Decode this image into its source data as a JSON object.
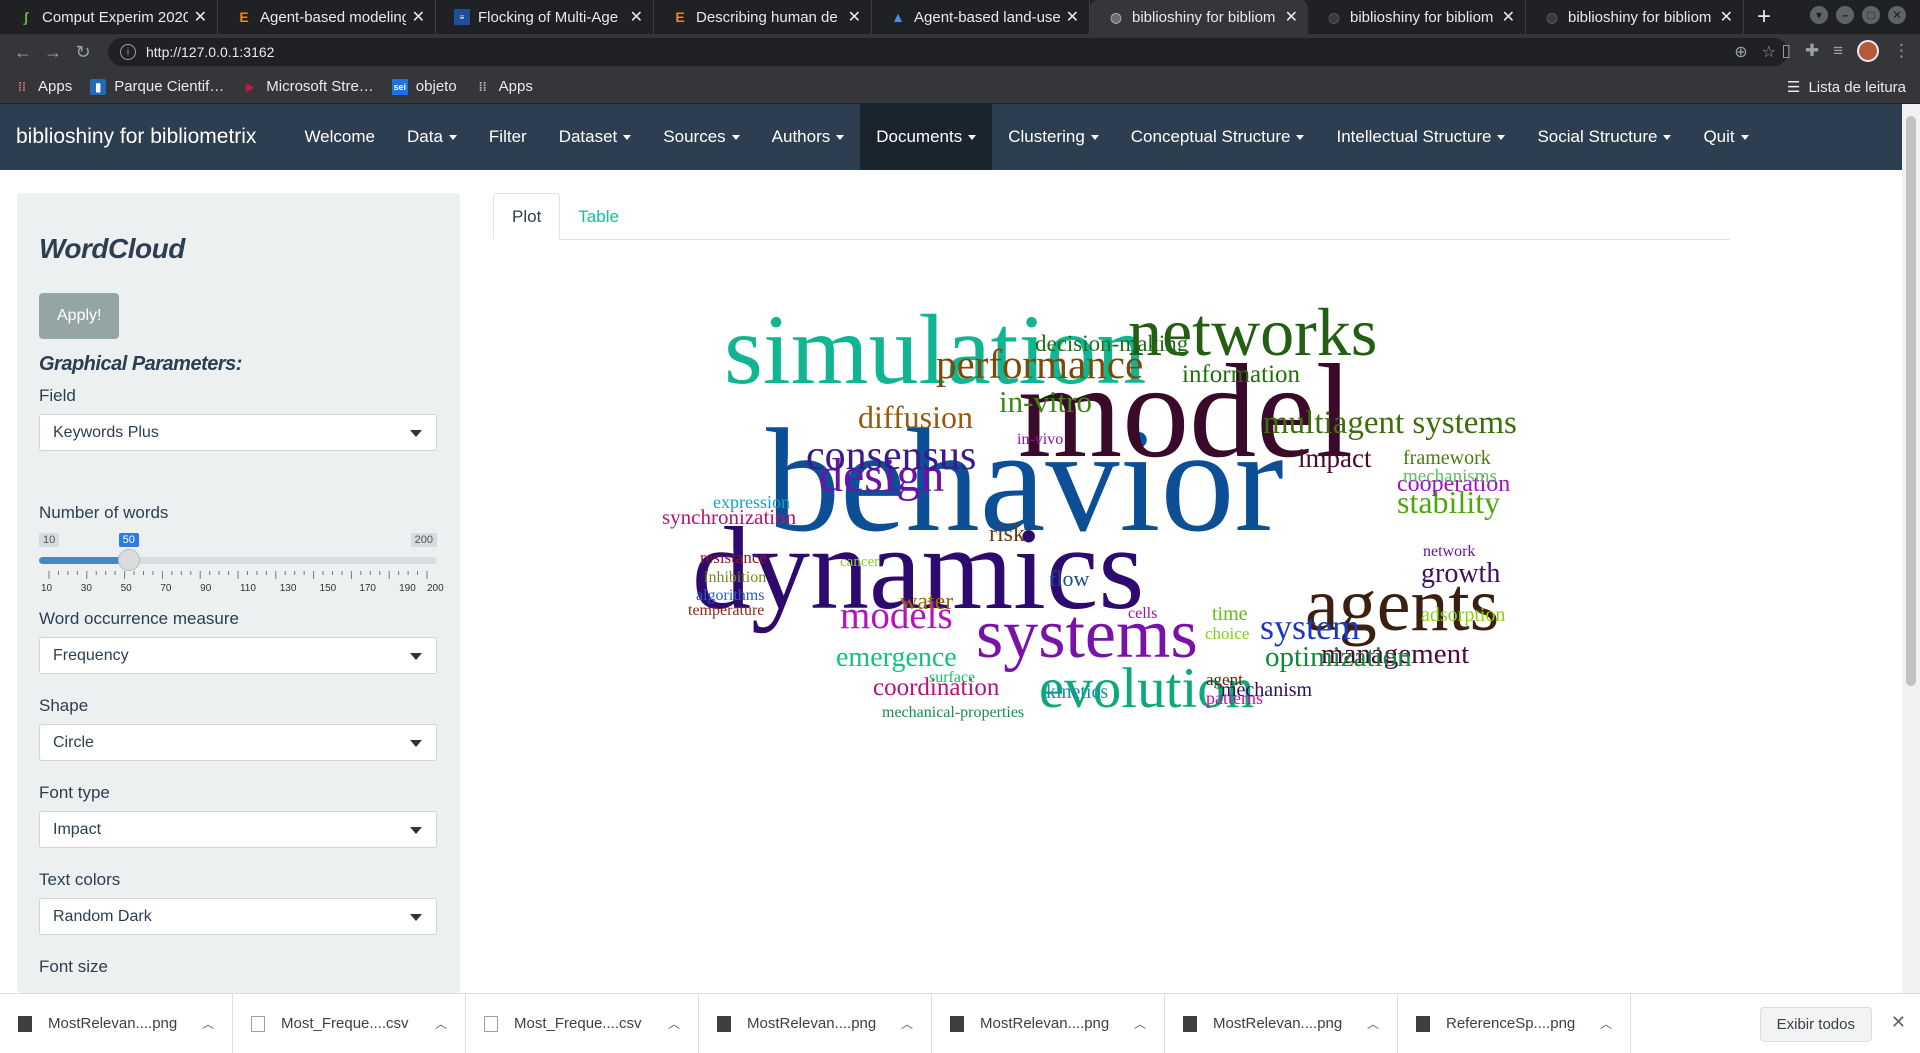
{
  "browser": {
    "tabs": [
      {
        "title": "Comput Experim 2020",
        "icon": "leaf-icon",
        "active": false
      },
      {
        "title": "Agent-based modeling",
        "icon": "elsevier-e-icon",
        "active": false
      },
      {
        "title": "Flocking of Multi-Age",
        "icon": "ieee-icon",
        "active": false
      },
      {
        "title": "Describing human de",
        "icon": "elsevier-e-icon",
        "active": false
      },
      {
        "title": "Agent-based land-use",
        "icon": "scholar-icon",
        "active": false
      },
      {
        "title": "biblioshiny for bibliom",
        "icon": "globe-icon",
        "active": true
      },
      {
        "title": "biblioshiny for bibliom",
        "icon": "globe-icon",
        "active": false
      },
      {
        "title": "biblioshiny for bibliom",
        "icon": "globe-icon",
        "active": false
      }
    ],
    "url": "http://127.0.0.1:3162",
    "bookmarks": [
      {
        "label": "Apps",
        "icon": "apps-grid-icon"
      },
      {
        "label": "Parque Cientif…",
        "icon": "trello-icon"
      },
      {
        "label": "Microsoft Stre…",
        "icon": "stream-icon"
      },
      {
        "label": "objeto",
        "icon": "sei-icon"
      },
      {
        "label": "Apps",
        "icon": "apps-grid-icon"
      }
    ],
    "reading_list": "Lista de leitura"
  },
  "navbar": {
    "brand": "biblioshiny for bibliometrix",
    "items": [
      {
        "label": "Welcome",
        "dropdown": false
      },
      {
        "label": "Data",
        "dropdown": true
      },
      {
        "label": "Filter",
        "dropdown": false
      },
      {
        "label": "Dataset",
        "dropdown": true
      },
      {
        "label": "Sources",
        "dropdown": true
      },
      {
        "label": "Authors",
        "dropdown": true
      },
      {
        "label": "Documents",
        "dropdown": true,
        "active": true
      },
      {
        "label": "Clustering",
        "dropdown": true
      },
      {
        "label": "Conceptual Structure",
        "dropdown": true
      },
      {
        "label": "Intellectual Structure",
        "dropdown": true
      },
      {
        "label": "Social Structure",
        "dropdown": true
      },
      {
        "label": "Quit",
        "dropdown": true
      }
    ]
  },
  "sidebar": {
    "title": "WordCloud",
    "apply_label": "Apply!",
    "graphical_params": "Graphical Parameters:",
    "field_label": "Field",
    "field_value": "Keywords Plus",
    "nwords_label": "Number of words",
    "slider": {
      "min": 10,
      "max": 200,
      "value": 50,
      "min_label": "10",
      "max_label": "200",
      "value_label": "50",
      "tick_labels": [
        "10",
        "30",
        "50",
        "70",
        "90",
        "110",
        "130",
        "150",
        "170",
        "190",
        "200"
      ]
    },
    "measure_label": "Word occurrence measure",
    "measure_value": "Frequency",
    "shape_label": "Shape",
    "shape_value": "Circle",
    "font_label": "Font type",
    "font_value": "Impact",
    "colors_label": "Text colors",
    "colors_value": "Random Dark",
    "fontsize_label": "Font size"
  },
  "panel_tabs": [
    {
      "label": "Plot",
      "active": true
    },
    {
      "label": "Table",
      "active": false
    }
  ],
  "wordcloud": [
    {
      "word": "behavior",
      "color": "#0d4f96"
    },
    {
      "word": "model",
      "color": "#3a0a2a"
    },
    {
      "word": "dynamics",
      "color": "#2e0a6e"
    },
    {
      "word": "simulation",
      "color": "#11b592"
    },
    {
      "word": "agents",
      "color": "#3b1f10"
    },
    {
      "word": "networks",
      "color": "#245e12"
    },
    {
      "word": "systems",
      "color": "#7912a8"
    },
    {
      "word": "evolution",
      "color": "#0fa87a"
    },
    {
      "word": "design",
      "color": "#6c12a6"
    },
    {
      "word": "consensus",
      "color": "#3a1a8c"
    },
    {
      "word": "performance",
      "color": "#7a4a0a"
    },
    {
      "word": "multiagent systems",
      "color": "#3c6e0a"
    },
    {
      "word": "models",
      "color": "#b512c2"
    },
    {
      "word": "system",
      "color": "#1a38c2"
    },
    {
      "word": "growth",
      "color": "#3a1060"
    },
    {
      "word": "management",
      "color": "#4a0a38"
    },
    {
      "word": "optimization",
      "color": "#0c8a3a"
    },
    {
      "word": "information",
      "color": "#226e10"
    },
    {
      "word": "in-vitro",
      "color": "#3c8a10"
    },
    {
      "word": "diffusion",
      "color": "#9a5a0a"
    },
    {
      "word": "decision-making",
      "color": "#1c6a1a"
    },
    {
      "word": "impact",
      "color": "#4a0a30"
    },
    {
      "word": "stability",
      "color": "#4aa80c"
    },
    {
      "word": "cooperation",
      "color": "#9a12c2"
    },
    {
      "word": "emergence",
      "color": "#12c283"
    },
    {
      "word": "coordination",
      "color": "#b8127a"
    },
    {
      "word": "water",
      "color": "#9a6a0a"
    },
    {
      "word": "flow",
      "color": "#1a4a8a"
    },
    {
      "word": "risk",
      "color": "#6a3a10"
    },
    {
      "word": "framework",
      "color": "#4a7a10"
    },
    {
      "word": "mechanisms",
      "color": "#5ac25a"
    },
    {
      "word": "adsorption",
      "color": "#8ad212"
    },
    {
      "word": "synchronization",
      "color": "#b81270"
    },
    {
      "word": "expression",
      "color": "#12a2c2"
    },
    {
      "word": "kinetics",
      "color": "#1a8aa8"
    },
    {
      "word": "mechanism",
      "color": "#2a125a"
    },
    {
      "word": "time",
      "color": "#5ac212"
    },
    {
      "word": "choice",
      "color": "#7ad212"
    },
    {
      "word": "agent",
      "color": "#5a2a0a"
    },
    {
      "word": "patterns",
      "color": "#c212a2"
    },
    {
      "word": "network",
      "color": "#6a12a2"
    },
    {
      "word": "resistance",
      "color": "#8a1a2a"
    },
    {
      "word": "inhibition",
      "color": "#7a8a12"
    },
    {
      "word": "algorithms",
      "color": "#2a5ad2"
    },
    {
      "word": "temperature",
      "color": "#8a2a10"
    },
    {
      "word": "cancer",
      "color": "#8ad212"
    },
    {
      "word": "cells",
      "color": "#a212a2"
    },
    {
      "word": "surface",
      "color": "#12c262"
    },
    {
      "word": "in-vivo",
      "color": "#8a12a2"
    },
    {
      "word": "mechanical-properties",
      "color": "#1a8a4a"
    }
  ],
  "downloads": [
    {
      "name": "MostRelevan....png",
      "type": "png"
    },
    {
      "name": "Most_Freque....csv",
      "type": "csv"
    },
    {
      "name": "Most_Freque....csv",
      "type": "csv"
    },
    {
      "name": "MostRelevan....png",
      "type": "png"
    },
    {
      "name": "MostRelevan....png",
      "type": "png"
    },
    {
      "name": "MostRelevan....png",
      "type": "png"
    },
    {
      "name": "ReferenceSp....png",
      "type": "png"
    }
  ],
  "downloads_show_all": "Exibir todos"
}
